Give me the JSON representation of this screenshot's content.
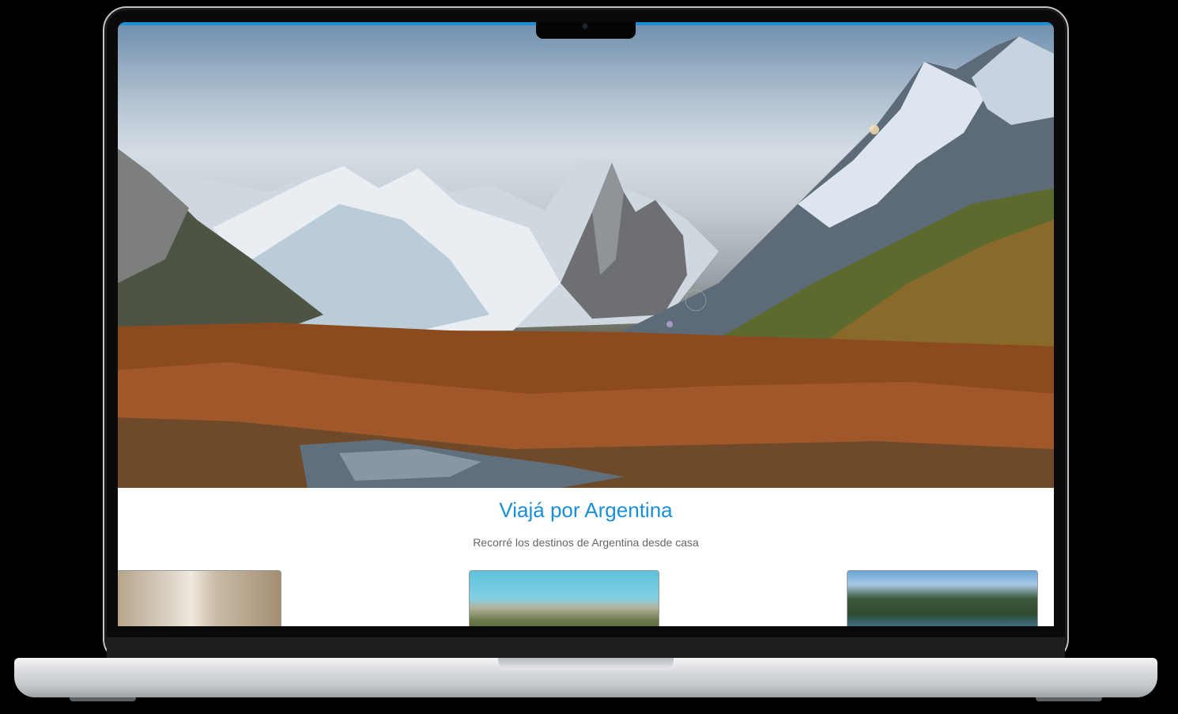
{
  "hero": {
    "image": "patagonia-mountain-landscape"
  },
  "page": {
    "title": "Viajá por Argentina",
    "subtitle": "Recorré los destinos de Argentina desde casa"
  },
  "destinations": [
    {
      "image": "cactus-wood-photo"
    },
    {
      "image": "mountain-valley-photo"
    },
    {
      "image": "lake-forest-hotel-photo"
    }
  ],
  "colors": {
    "accent": "#1a8fd6",
    "subtitle": "#666666"
  }
}
